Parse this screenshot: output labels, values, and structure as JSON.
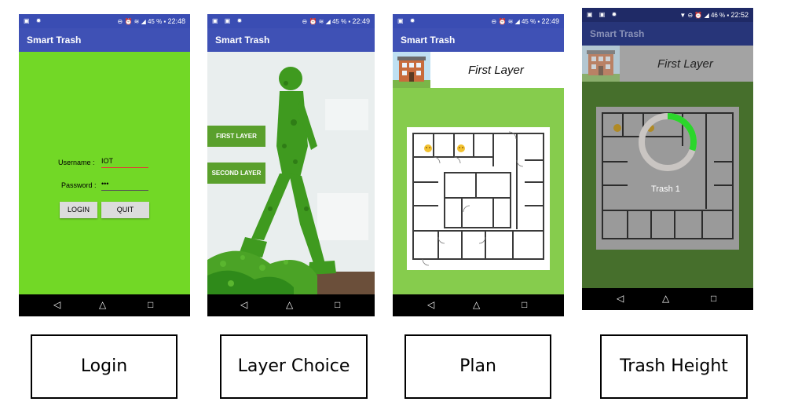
{
  "status_bars": [
    {
      "left_icons": "▣ ✹",
      "right_icons": "⊖ ⏰ ≋ ◢ 45 % ▪",
      "time": "22:48"
    },
    {
      "left_icons": "▣ ▣ ✹",
      "right_icons": "⊖ ⏰ ≋ ◢ 45 % ▪",
      "time": "22:49"
    },
    {
      "left_icons": "▣ ✹",
      "right_icons": "⊖ ⏰ ≋ ◢ 45 % ▪",
      "time": "22:49"
    },
    {
      "left_icons": "▣ ▣ ✹",
      "right_icons": "▼ ⊖ ⏰ ◢ 46 % ▪",
      "time": "22:52"
    }
  ],
  "app_title": "Smart Trash",
  "login": {
    "username_label": "Username :",
    "username_value": "IOT",
    "password_label": "Password :",
    "password_value": "•••",
    "login_button": "LOGIN",
    "quit_button": "QUIT"
  },
  "layer_choice": {
    "first_layer_button": "FIRST LAYER",
    "second_layer_button": "SECOND LAYER"
  },
  "plan": {
    "layer_title": "First Layer"
  },
  "trash_height": {
    "layer_title": "First Layer",
    "gauge_label": "Trash 1",
    "gauge_fill": 0.3
  },
  "nav_icons": [
    "◁",
    "△",
    "□"
  ],
  "captions": [
    "Login",
    "Layer Choice",
    "Plan",
    "Trash Height"
  ],
  "colors": {
    "appbar": "#3f51b5",
    "login_bg": "#72d826",
    "plan_bg": "#86cc4d",
    "gauge_fill": "#2bd62b"
  }
}
